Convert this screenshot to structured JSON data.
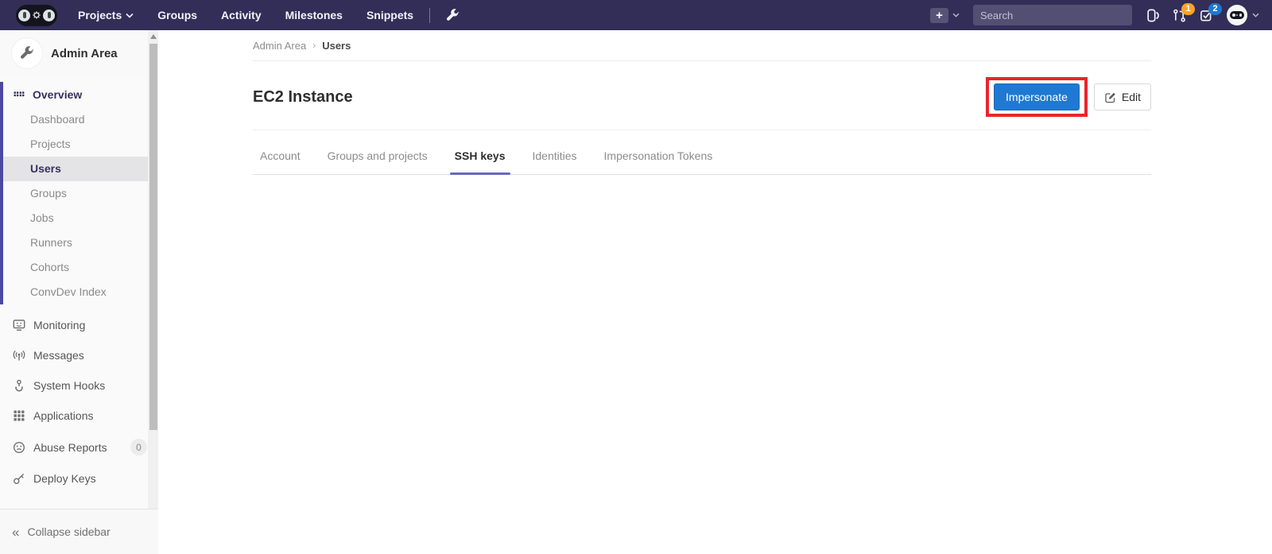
{
  "navbar": {
    "menu": [
      {
        "label": "Projects"
      },
      {
        "label": "Groups"
      },
      {
        "label": "Activity"
      },
      {
        "label": "Milestones"
      },
      {
        "label": "Snippets"
      }
    ],
    "search": {
      "placeholder": "Search"
    },
    "merge_requests_badge": "1",
    "todos_badge": "2"
  },
  "sidebar": {
    "title": "Admin Area",
    "overview": {
      "label": "Overview",
      "items": [
        "Dashboard",
        "Projects",
        "Users",
        "Groups",
        "Jobs",
        "Runners",
        "Cohorts",
        "ConvDev Index"
      ],
      "active_item": "Users"
    },
    "items": [
      {
        "label": "Monitoring"
      },
      {
        "label": "Messages"
      },
      {
        "label": "System Hooks"
      },
      {
        "label": "Applications"
      },
      {
        "label": "Abuse Reports",
        "badge": "0"
      },
      {
        "label": "Deploy Keys"
      }
    ],
    "collapse_label": "Collapse sidebar",
    "collapse_glyph": "«"
  },
  "breadcrumb": {
    "parent": "Admin Area",
    "separator": "›",
    "current": "Users"
  },
  "page": {
    "title": "EC2 Instance",
    "actions": {
      "impersonate": "Impersonate",
      "edit": "Edit"
    }
  },
  "tabs": {
    "items": [
      "Account",
      "Groups and projects",
      "SSH keys",
      "Identities",
      "Impersonation Tokens"
    ],
    "active": "SSH keys"
  },
  "colors": {
    "navbar_bg": "#322e58",
    "accent_blue": "#1f78d1",
    "badge_orange": "#fca326",
    "badge_blue": "#1f78d1",
    "sidebar_active_indicator": "#4c4aa0",
    "tab_underline": "#6668c4",
    "annotation_red": "#e8262b"
  },
  "misc": {
    "plus_glyph": "+"
  }
}
